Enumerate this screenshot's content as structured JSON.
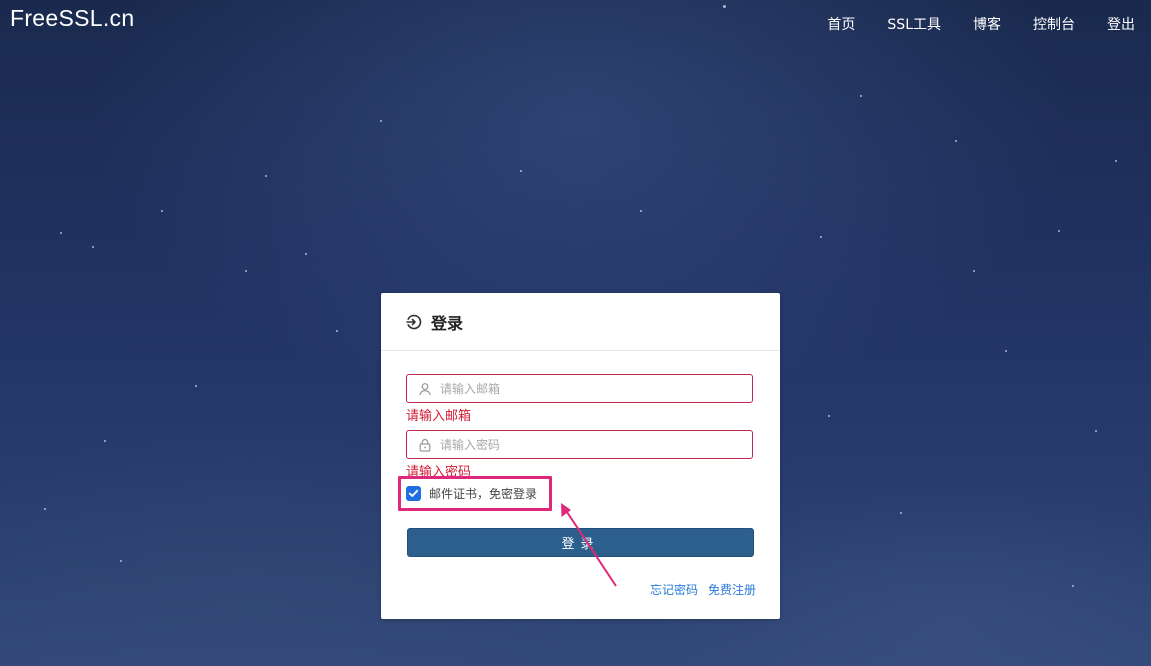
{
  "header": {
    "logo": "FreeSSL.cn",
    "nav": [
      {
        "label": "首页"
      },
      {
        "label": "SSL工具"
      },
      {
        "label": "博客"
      },
      {
        "label": "控制台"
      },
      {
        "label": "登出"
      }
    ]
  },
  "login": {
    "title": "登录",
    "email": {
      "placeholder": "请输入邮箱",
      "value": "",
      "error": "请输入邮箱"
    },
    "password": {
      "placeholder": "请输入密码",
      "value": "",
      "error": "请输入密码"
    },
    "remember": {
      "label": "邮件证书，免密登录",
      "checked": true
    },
    "submit_label": "登录",
    "forgot_label": "忘记密码",
    "register_label": "免费注册"
  },
  "colors": {
    "accent": "#1f6fe0",
    "button": "#2c5f8c",
    "error": "#d11d35",
    "annotation": "#e0287a"
  },
  "icons": [
    "login-icon",
    "user-icon",
    "lock-icon",
    "check-icon"
  ]
}
